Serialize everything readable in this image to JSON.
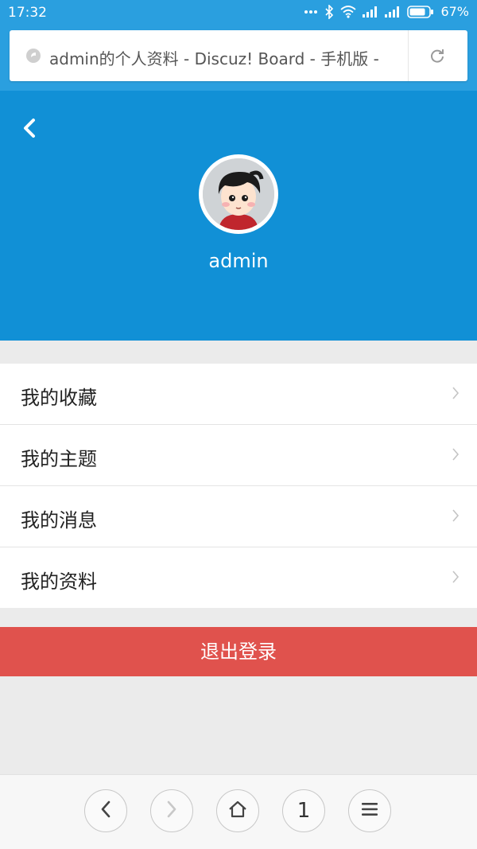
{
  "status_bar": {
    "time": "17:32",
    "battery_percent_label": "67%",
    "icons": [
      "dots-icon",
      "bluetooth-icon",
      "wifi-icon",
      "signal-icon",
      "signal-icon",
      "battery-icon"
    ]
  },
  "browser": {
    "page_title": "admin的个人资料 - Discuz! Board - 手机版 -",
    "refresh_icon": "refresh-icon"
  },
  "profile": {
    "username": "admin",
    "back_icon": "back-arrow-icon"
  },
  "menu": {
    "items": [
      {
        "label": "我的收藏"
      },
      {
        "label": "我的主题"
      },
      {
        "label": "我的消息"
      },
      {
        "label": "我的资料"
      }
    ]
  },
  "logout_label": "退出登录",
  "bottom_nav": {
    "tab_count": "1",
    "icons": [
      "back-icon",
      "forward-icon",
      "home-icon",
      "tabs-icon",
      "menu-icon"
    ]
  },
  "colors": {
    "status_bar": "#2a9fdf",
    "header": "#1190d6",
    "logout": "#e0524d",
    "background": "#ebebeb"
  }
}
